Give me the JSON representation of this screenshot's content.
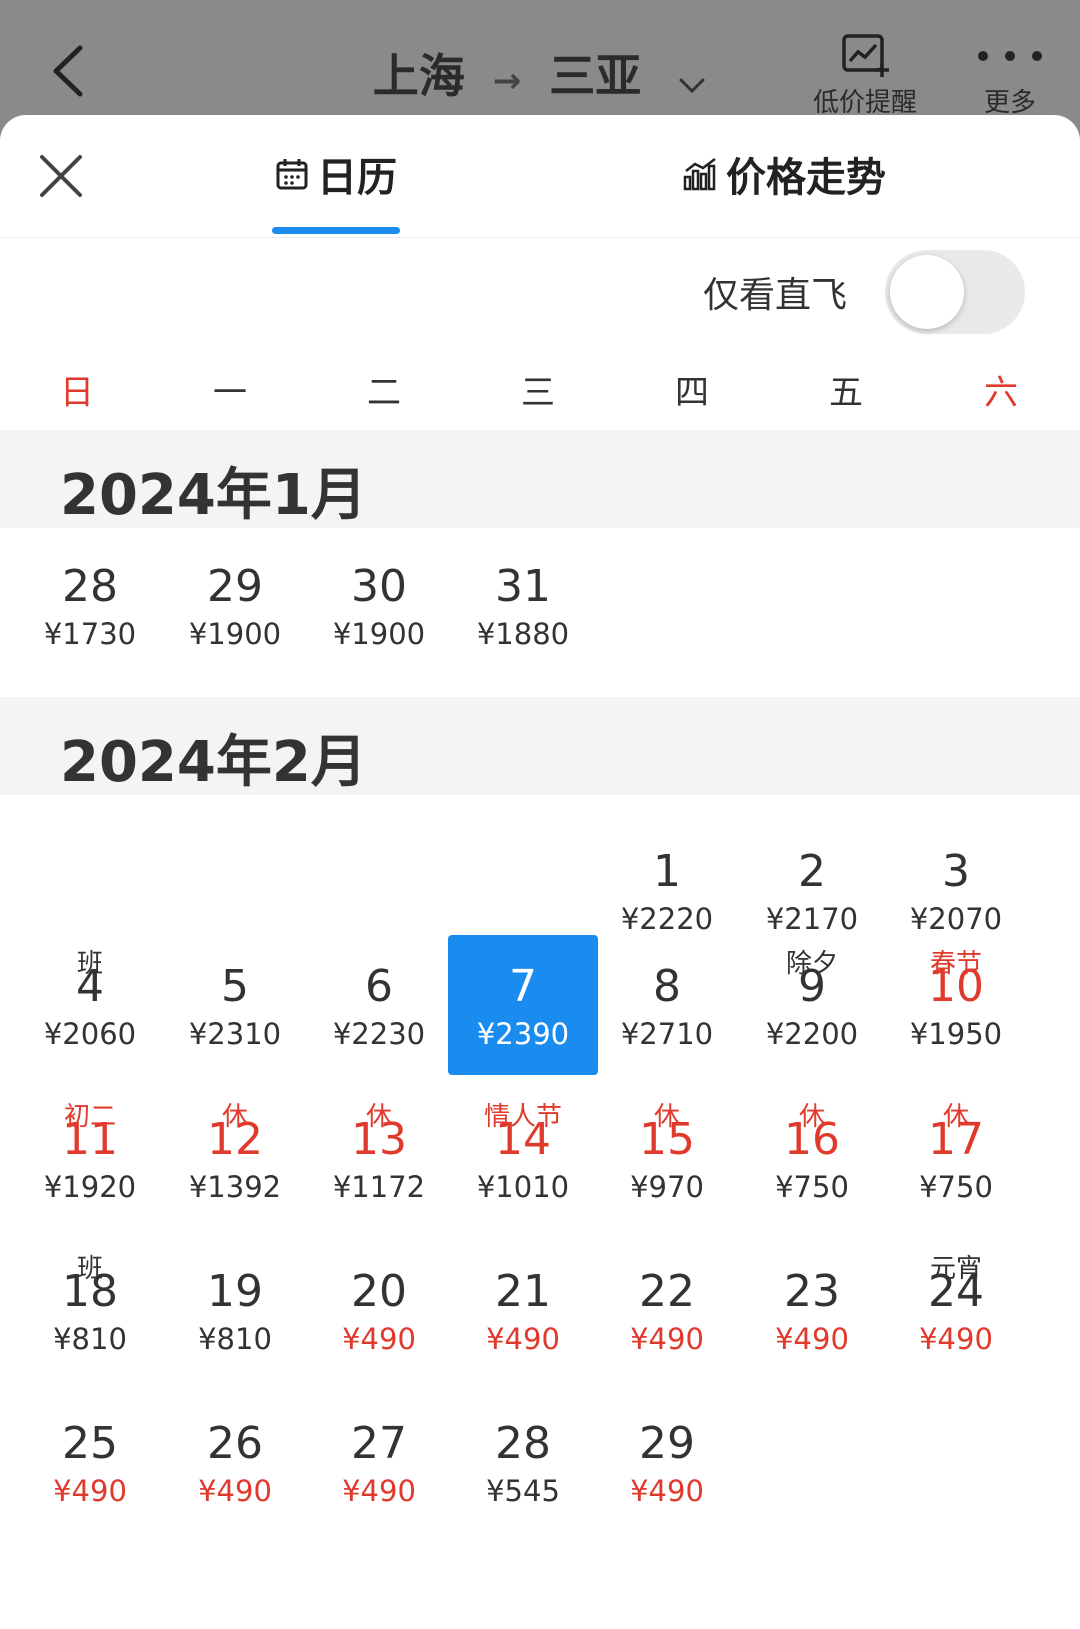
{
  "header": {
    "origin": "上海",
    "destination": "三亚",
    "actions": {
      "price_alert": "低价提醒",
      "more": "更多"
    }
  },
  "tabs": {
    "calendar": "日历",
    "trend": "价格走势"
  },
  "filter": {
    "direct_only_label": "仅看直飞",
    "direct_only_on": false
  },
  "weekdays": [
    "日",
    "一",
    "二",
    "三",
    "四",
    "五",
    "六"
  ],
  "colors": {
    "accent": "#1a8cf0",
    "holiday": "#e03a2c"
  },
  "months": [
    {
      "title": "2024年1月",
      "days": [
        {
          "day": "28",
          "price": "¥1730",
          "tag": ""
        },
        {
          "day": "29",
          "price": "¥1900",
          "tag": ""
        },
        {
          "day": "30",
          "price": "¥1900",
          "tag": ""
        },
        {
          "day": "31",
          "price": "¥1880",
          "tag": ""
        }
      ]
    },
    {
      "title": "2024年2月",
      "days": [
        {
          "day": "1",
          "price": "¥2220",
          "tag": ""
        },
        {
          "day": "2",
          "price": "¥2170",
          "tag": ""
        },
        {
          "day": "3",
          "price": "¥2070",
          "tag": ""
        },
        {
          "day": "4",
          "price": "¥2060",
          "tag": "班"
        },
        {
          "day": "5",
          "price": "¥2310",
          "tag": ""
        },
        {
          "day": "6",
          "price": "¥2230",
          "tag": ""
        },
        {
          "day": "7",
          "price": "¥2390",
          "tag": "",
          "selected": true
        },
        {
          "day": "8",
          "price": "¥2710",
          "tag": ""
        },
        {
          "day": "9",
          "price": "¥2200",
          "tag": "除夕"
        },
        {
          "day": "10",
          "price": "¥1950",
          "tag": "春节",
          "holiday": true
        },
        {
          "day": "11",
          "price": "¥1920",
          "tag": "初二",
          "holiday": true
        },
        {
          "day": "12",
          "price": "¥1392",
          "tag": "休",
          "holiday": true
        },
        {
          "day": "13",
          "price": "¥1172",
          "tag": "休",
          "holiday": true
        },
        {
          "day": "14",
          "price": "¥1010",
          "tag": "情人节",
          "holiday": true
        },
        {
          "day": "15",
          "price": "¥970",
          "tag": "休",
          "holiday": true
        },
        {
          "day": "16",
          "price": "¥750",
          "tag": "休",
          "holiday": true
        },
        {
          "day": "17",
          "price": "¥750",
          "tag": "休",
          "holiday": true
        },
        {
          "day": "18",
          "price": "¥810",
          "tag": "班"
        },
        {
          "day": "19",
          "price": "¥810",
          "tag": ""
        },
        {
          "day": "20",
          "price": "¥490",
          "tag": "",
          "low": true
        },
        {
          "day": "21",
          "price": "¥490",
          "tag": "",
          "low": true
        },
        {
          "day": "22",
          "price": "¥490",
          "tag": "",
          "low": true
        },
        {
          "day": "23",
          "price": "¥490",
          "tag": "",
          "low": true
        },
        {
          "day": "24",
          "price": "¥490",
          "tag": "元宵",
          "low": true
        },
        {
          "day": "25",
          "price": "¥490",
          "tag": "",
          "low": true
        },
        {
          "day": "26",
          "price": "¥490",
          "tag": "",
          "low": true
        },
        {
          "day": "27",
          "price": "¥490",
          "tag": "",
          "low": true
        },
        {
          "day": "28",
          "price": "¥545",
          "tag": ""
        },
        {
          "day": "29",
          "price": "¥490",
          "tag": "",
          "low": true
        }
      ]
    }
  ]
}
